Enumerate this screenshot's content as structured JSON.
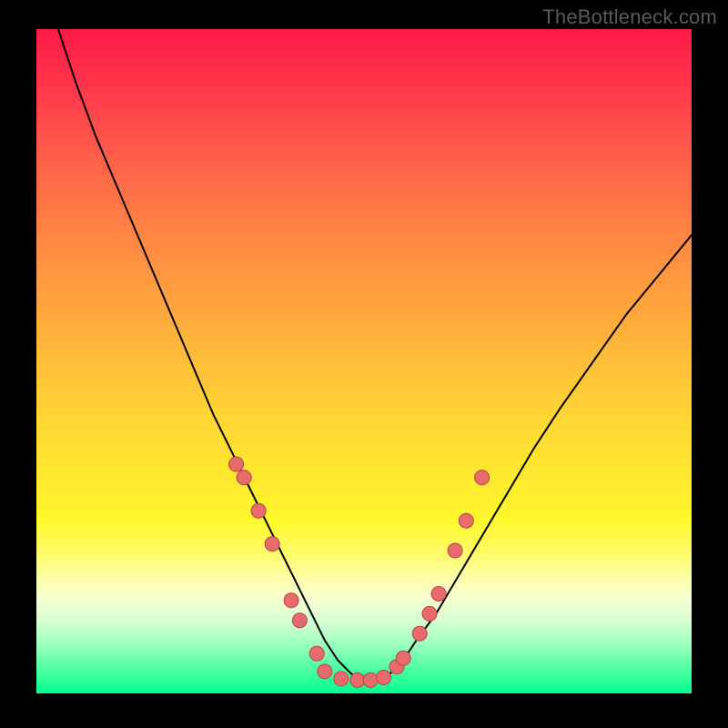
{
  "watermark": {
    "text": "TheBottleneck.com"
  },
  "colors": {
    "background": "#000000",
    "curve_stroke": "#000000",
    "dot_fill": "#e86a6a",
    "dot_stroke": "#b24848"
  },
  "chart_data": {
    "type": "line",
    "title": "",
    "xlabel": "",
    "ylabel": "",
    "xlim": [
      0,
      100
    ],
    "ylim": [
      0,
      100
    ],
    "grid": false,
    "note": "Axes are unlabeled; x is a normalized component-balance parameter, y is bottleneck percentage. Values are estimated from pixel positions against implied 0–100 scales.",
    "series": [
      {
        "name": "bottleneck-curve",
        "x": [
          0,
          3,
          6,
          9,
          12,
          15,
          18,
          21,
          24,
          27,
          30,
          33,
          36,
          38,
          40,
          42,
          44,
          46,
          48,
          50,
          52,
          54,
          56,
          58,
          61,
          64,
          67,
          70,
          73,
          76,
          80,
          85,
          90,
          95,
          100
        ],
        "values": [
          110,
          101,
          92,
          84,
          77,
          70,
          63,
          56,
          49,
          42,
          36,
          30,
          24,
          20,
          16,
          12,
          8,
          5,
          3,
          2,
          2,
          3,
          5,
          8,
          12,
          17,
          22,
          27,
          32,
          37,
          43,
          50,
          57,
          63,
          69
        ]
      }
    ],
    "markers": [
      {
        "name": "left-branch-dots",
        "note": "Highlighted sample points on the descending branch near the optimum",
        "x": [
          30.5,
          31.7,
          33.9,
          36.0,
          38.9,
          40.2,
          42.8
        ],
        "values": [
          34.5,
          32.5,
          27.5,
          22.5,
          14.0,
          11.0,
          6.0
        ]
      },
      {
        "name": "trough-dots",
        "note": "Flat optimum region",
        "x": [
          44.0,
          46.5,
          49.0,
          51.0,
          53.0
        ],
        "values": [
          3.3,
          2.2,
          2.0,
          2.0,
          2.4
        ]
      },
      {
        "name": "right-branch-dots",
        "note": "Highlighted sample points on the ascending branch",
        "x": [
          55.0,
          56.0,
          58.5,
          60.0,
          61.4,
          63.9,
          65.6,
          68.0
        ],
        "values": [
          4.0,
          5.3,
          9.0,
          12.0,
          15.0,
          21.5,
          26.0,
          32.5
        ]
      }
    ]
  }
}
